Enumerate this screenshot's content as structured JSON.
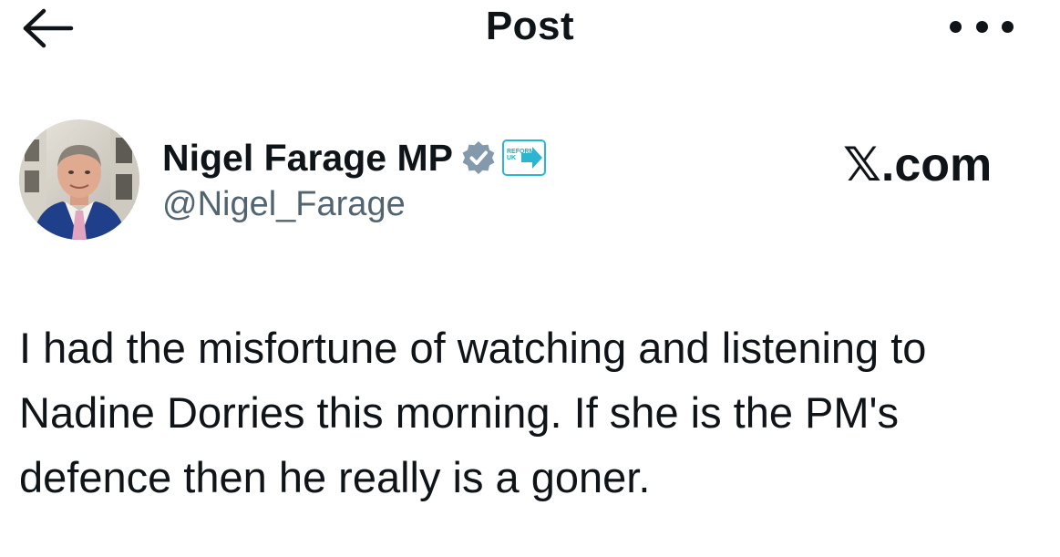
{
  "header": {
    "title": "Post",
    "back_icon": "arrow-left-icon",
    "more_icon": "more-horizontal-icon"
  },
  "author": {
    "name": "Nigel Farage MP",
    "handle": "@Nigel_Farage",
    "verified_icon": "verified-badge-icon",
    "affiliation_badge_text": "REFORM UK",
    "avatar_icon": "profile-photo"
  },
  "source": {
    "label": "𝕏.com"
  },
  "tweet": {
    "text": "I had the misfortune of watching and listening to Nadine Dorries this morning. If she is the PM's defence then he really is a goner."
  },
  "colors": {
    "text_primary": "#0f1419",
    "text_secondary": "#536471",
    "verified_grey": "#829aab",
    "affiliation_teal": "#2ab5d0"
  }
}
